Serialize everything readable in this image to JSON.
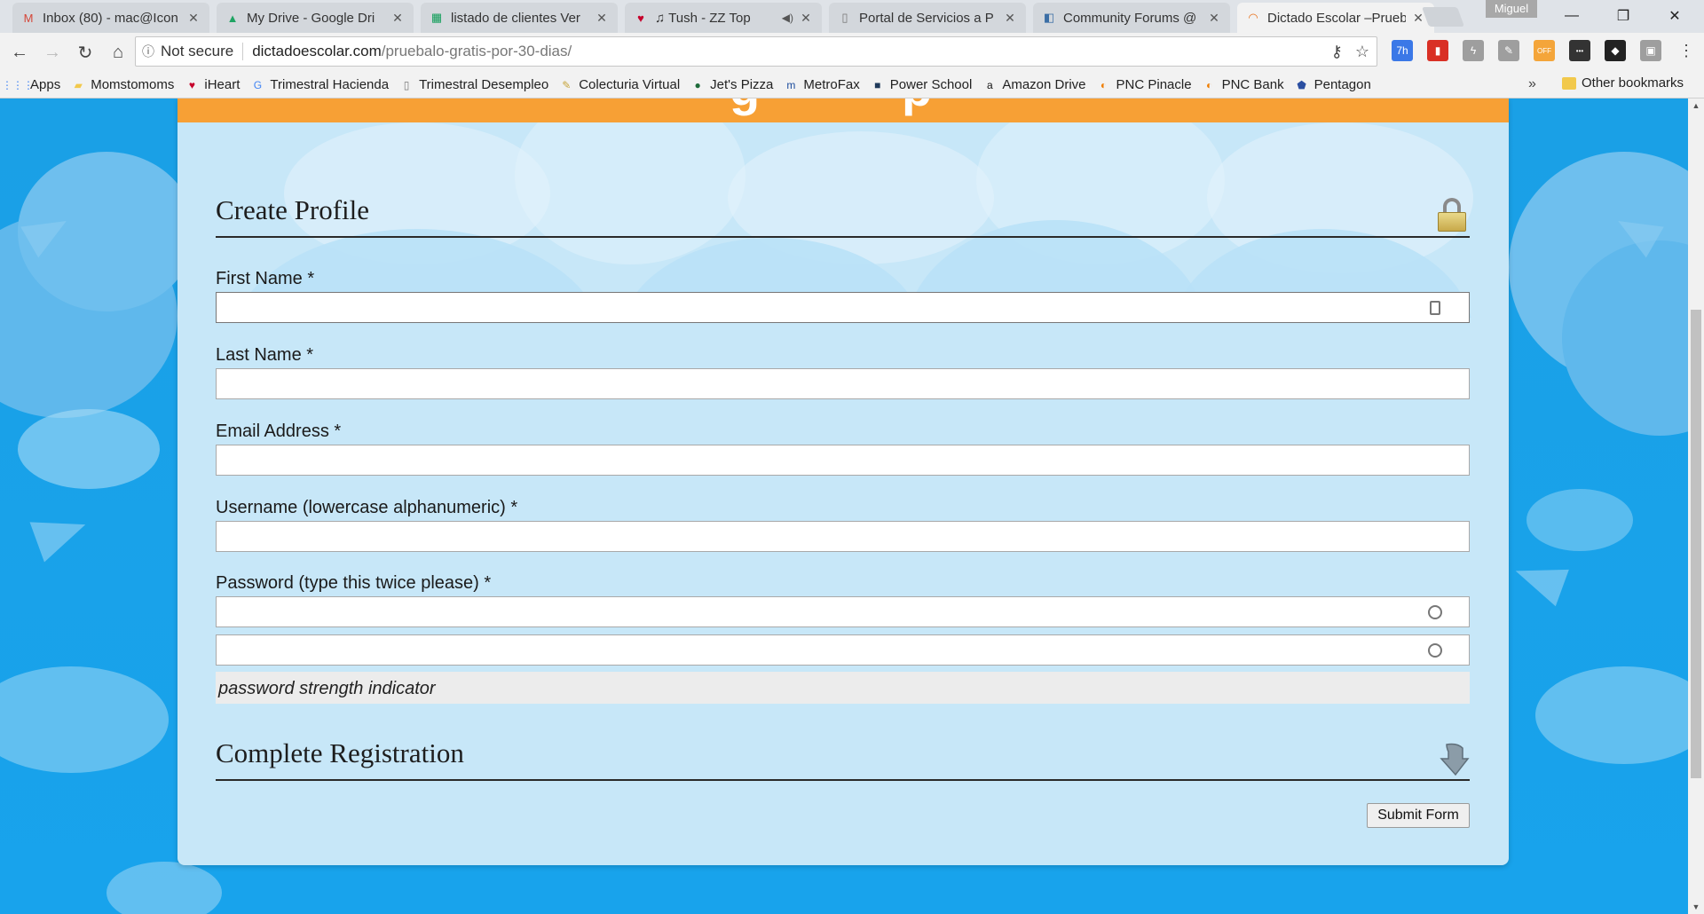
{
  "browser": {
    "tabs": [
      {
        "title": "Inbox (80) - mac@Icon",
        "favicon": "M",
        "favicon_color": "#d44638"
      },
      {
        "title": "My Drive - Google Dri",
        "favicon": "▲",
        "favicon_color": "#1fa463"
      },
      {
        "title": "listado de clientes Ver",
        "favicon": "▦",
        "favicon_color": "#0f9d58"
      },
      {
        "title": "♫ Tush - ZZ Top",
        "favicon": "♥",
        "favicon_color": "#c6002b",
        "audio": "◀)"
      },
      {
        "title": "Portal de Servicios a P",
        "favicon": "▯",
        "favicon_color": "#777777"
      },
      {
        "title": "Community Forums @",
        "favicon": "◧",
        "favicon_color": "#3b6ea5"
      },
      {
        "title": "Dictado Escolar –Prueb",
        "favicon": "◠",
        "favicon_color": "#e8711c",
        "active": true
      }
    ],
    "profile_name": "Miguel",
    "window_controls": {
      "minimize": "—",
      "restore": "❐",
      "close": "✕"
    },
    "address": {
      "security_label": "Not secure",
      "host": "dictadoescolar.com",
      "path": "/pruebalo-gratis-por-30-dias/"
    },
    "extensions": [
      {
        "name": "calendar-extension",
        "color": "#3b78e7",
        "text": "7h"
      },
      {
        "name": "pdf-extension",
        "color": "#d93025",
        "text": "▮"
      },
      {
        "name": "lightning-extension",
        "color": "#9e9e9e",
        "text": "ϟ"
      },
      {
        "name": "tools-extension",
        "color": "#9e9e9e",
        "text": "✎"
      },
      {
        "name": "feed-extension",
        "color": "#f4a53a",
        "text": "OFF"
      },
      {
        "name": "dots-extension",
        "color": "#333333",
        "text": "•••"
      },
      {
        "name": "shield-extension",
        "color": "#222222",
        "text": "◆"
      },
      {
        "name": "square-extension",
        "color": "#9e9e9e",
        "text": "▣"
      },
      {
        "name": "menu-extension",
        "color": "#f2f2f2",
        "text": "⋮"
      }
    ],
    "bookmarks": [
      {
        "label": "Apps",
        "icon": "⋮⋮⋮",
        "color": "#4285f4"
      },
      {
        "label": "Momstomoms",
        "icon": "▰",
        "color": "#f2c94c"
      },
      {
        "label": "iHeart",
        "icon": "♥",
        "color": "#c6002b"
      },
      {
        "label": "Trimestral Hacienda",
        "icon": "G",
        "color": "#4285f4"
      },
      {
        "label": "Trimestral Desempleo",
        "icon": "▯",
        "color": "#777777"
      },
      {
        "label": "Colecturia Virtual",
        "icon": "✎",
        "color": "#c7a43a"
      },
      {
        "label": "Jet's Pizza",
        "icon": "●",
        "color": "#1e6b3a"
      },
      {
        "label": "MetroFax",
        "icon": "m",
        "color": "#1a4a9c"
      },
      {
        "label": "Power School",
        "icon": "■",
        "color": "#1f3a5a"
      },
      {
        "label": "Amazon Drive",
        "icon": "a",
        "color": "#111111"
      },
      {
        "label": "PNC Pinacle",
        "icon": "◐",
        "color": "#ef7d00"
      },
      {
        "label": "PNC Bank",
        "icon": "◐",
        "color": "#ef7d00"
      },
      {
        "label": "Pentagon",
        "icon": "⬟",
        "color": "#2b4fa1"
      }
    ],
    "more_bookmarks": "»",
    "other_bookmarks": "Other bookmarks"
  },
  "form": {
    "create_profile_title": "Create Profile",
    "fields": {
      "first_name": {
        "label": "First Name *",
        "value": ""
      },
      "last_name": {
        "label": "Last Name *",
        "value": ""
      },
      "email": {
        "label": "Email Address *",
        "value": ""
      },
      "username": {
        "label": "Username (lowercase alphanumeric) *",
        "value": ""
      },
      "password": {
        "label": "Password (type this twice please) *",
        "value": "",
        "confirm_value": ""
      }
    },
    "strength_indicator": "password strength indicator",
    "complete_registration_title": "Complete Registration",
    "submit_label": "Submit Form"
  }
}
